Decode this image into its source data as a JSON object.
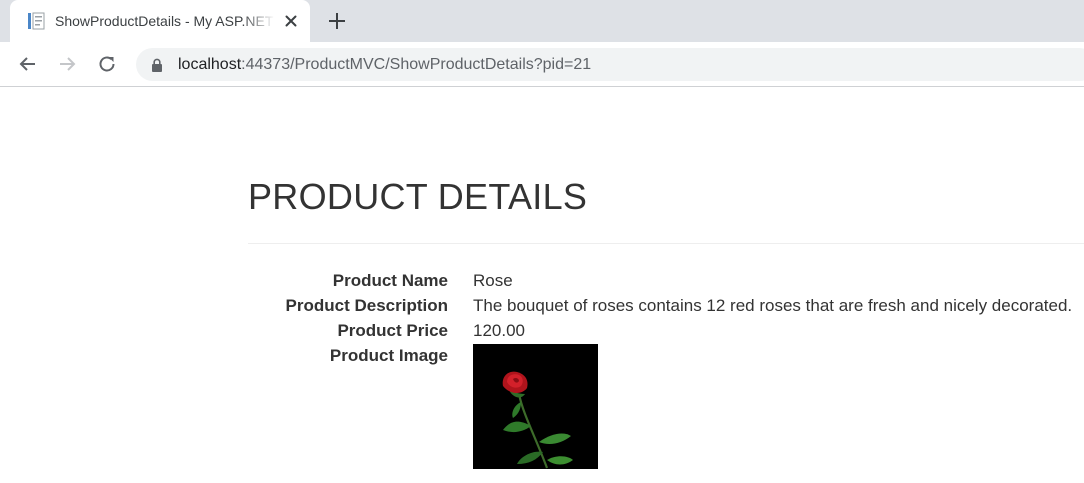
{
  "browser": {
    "tab": {
      "title": "ShowProductDetails - My ASP.NET Application",
      "favicon": "document-icon"
    },
    "address_bar": {
      "host": "localhost",
      "rest": ":44373/ProductMVC/ShowProductDetails?pid=21"
    }
  },
  "page": {
    "title": "PRODUCT DETAILS",
    "fields": [
      {
        "label": "Product Name",
        "value": "Rose"
      },
      {
        "label": "Product Description",
        "value": "The bouquet of roses contains 12 red roses that are fresh and nicely decorated."
      },
      {
        "label": "Product Price",
        "value": "120.00"
      },
      {
        "label": "Product Image",
        "value": ""
      }
    ],
    "image": {
      "subject": "red rose on black background",
      "icon": "rose-image"
    }
  },
  "colors": {
    "tabstrip": "#dee1e6",
    "omnibox": "#f1f3f4",
    "text": "#333333",
    "rose": "#c0141c",
    "leaf": "#2f7a2a"
  }
}
